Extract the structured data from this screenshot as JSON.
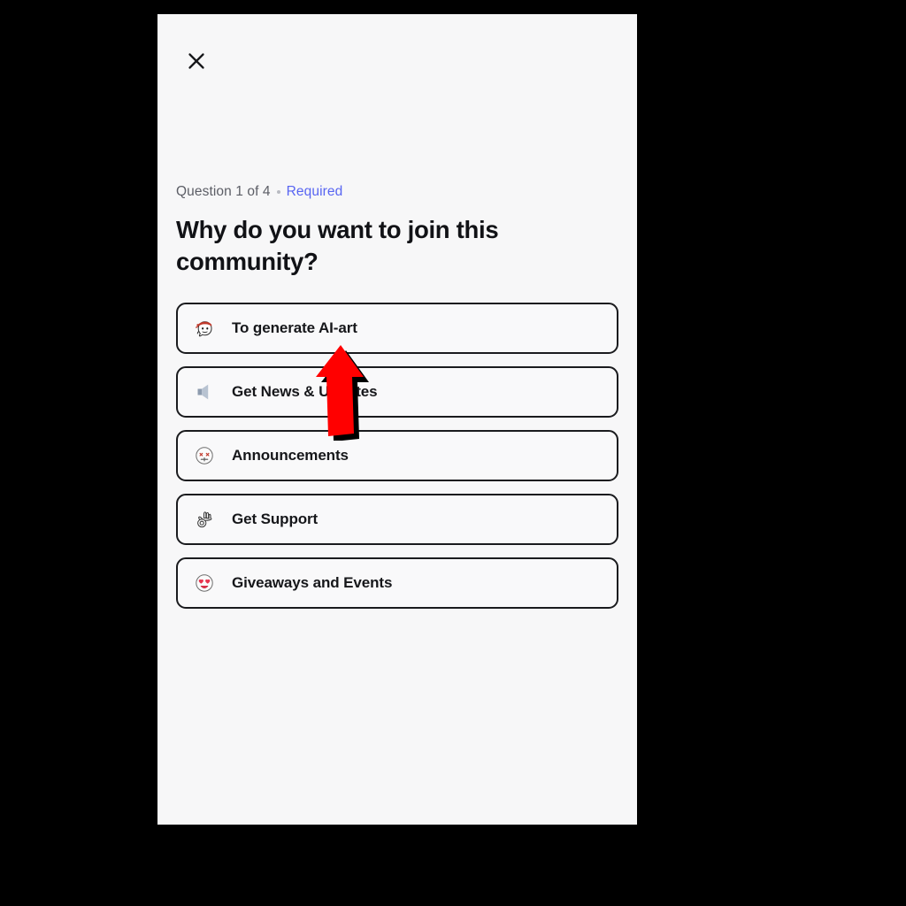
{
  "modal": {
    "close_icon": "close-icon",
    "meta": {
      "counter": "Question 1 of 4",
      "separator": "•",
      "required_label": "Required",
      "required_color": "#5865F2"
    },
    "question": "Why do you want to join this community?",
    "options": [
      {
        "label": "To generate AI-art",
        "icon": "ninja-emoji-icon"
      },
      {
        "label": "Get News & Updates",
        "icon": "speaker-icon"
      },
      {
        "label": "Announcements",
        "icon": "dizzy-face-emoji-icon"
      },
      {
        "label": "Get Support",
        "icon": "ok-hand-emoji-icon"
      },
      {
        "label": "Giveaways and Events",
        "icon": "heart-eyes-emoji-icon"
      }
    ]
  },
  "annotation": {
    "arrow_icon": "up-arrow-annotation-icon",
    "arrow_color": "#FF0000",
    "arrow_outline_color": "#000000",
    "targets_option_index": 0
  },
  "theme": {
    "page_background": "#000000",
    "panel_background": "#F7F7F8",
    "text_primary": "#111216",
    "text_muted": "#5C5E66",
    "border_color": "#1A1B1E"
  }
}
